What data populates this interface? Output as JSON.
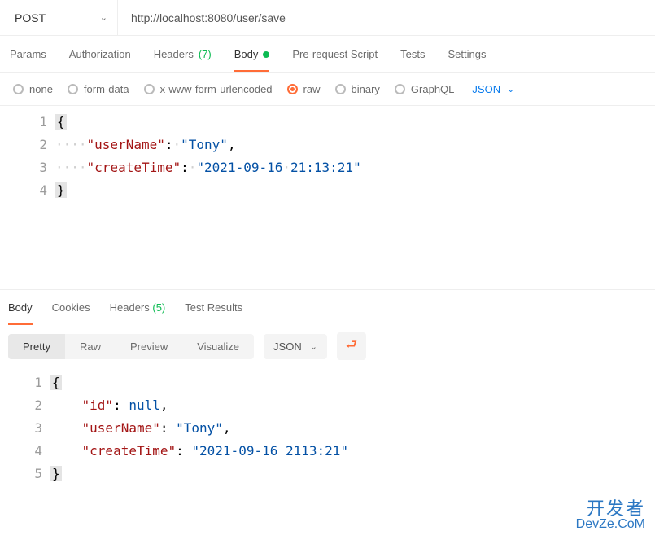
{
  "request": {
    "method": "POST",
    "url": "http://localhost:8080/user/save"
  },
  "tabs": {
    "params": "Params",
    "authorization": "Authorization",
    "headers_label": "Headers",
    "headers_count": "(7)",
    "body": "Body",
    "prerequest": "Pre-request Script",
    "tests": "Tests",
    "settings": "Settings"
  },
  "bodyTypes": {
    "none": "none",
    "formdata": "form-data",
    "xwww": "x-www-form-urlencoded",
    "raw": "raw",
    "binary": "binary",
    "graphql": "GraphQL"
  },
  "rawFormat": "JSON",
  "requestBody": {
    "lineNumbers": [
      "1",
      "2",
      "3",
      "4"
    ],
    "open": "{",
    "close": "}",
    "k_userName": "\"userName\"",
    "v_userName": "\"Tony\"",
    "k_createTime": "\"createTime\"",
    "v_createTime_a": "\"2021-09-16",
    "v_createTime_b": "21:13:21\""
  },
  "respTabs": {
    "body": "Body",
    "cookies": "Cookies",
    "headers_label": "Headers",
    "headers_count": "(5)",
    "testresults": "Test Results"
  },
  "respViews": {
    "pretty": "Pretty",
    "raw": "Raw",
    "preview": "Preview",
    "visualize": "Visualize"
  },
  "respFormat": "JSON",
  "responseBody": {
    "lineNumbers": [
      "1",
      "2",
      "3",
      "4",
      "5"
    ],
    "open": "{",
    "close": "}",
    "k_id": "\"id\"",
    "v_id": "null",
    "k_userName": "\"userName\"",
    "v_userName": "\"Tony\"",
    "k_createTime": "\"createTime\"",
    "v_createTime": "\"2021-09-16 2113:21\""
  },
  "watermark": {
    "zh": "开发者",
    "en": "DevZe.CoM"
  }
}
